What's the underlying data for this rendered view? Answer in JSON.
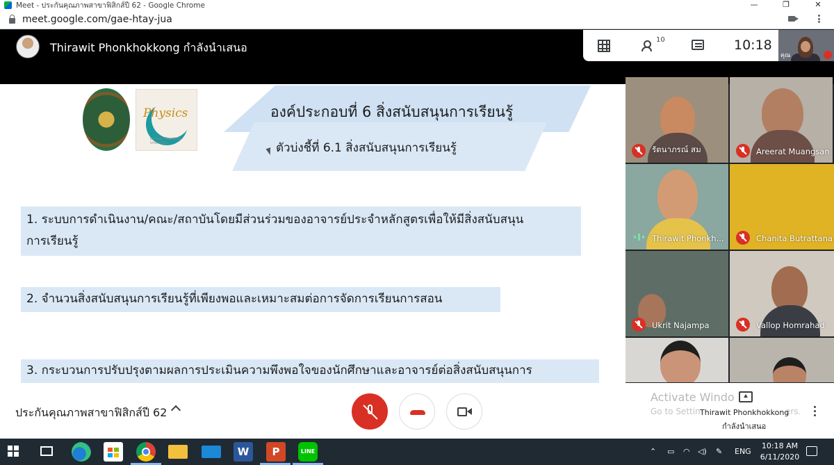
{
  "window": {
    "title": "Meet - ประกันคุณภาพสาขาฟิสิกส์ปี 62 - Google Chrome",
    "controls": [
      "—",
      "❐",
      "✕"
    ]
  },
  "browser": {
    "url": "meet.google.com/gae-htay-jua"
  },
  "header": {
    "presenting_text": "Thirawit Phonkhokkong กำลังนำเสนอ",
    "participants_count": "10",
    "clock": "10:18",
    "self_label": "คุณ"
  },
  "slide": {
    "title": "องค์ประกอบที่ 6 สิ่งสนับสนุนการเรียนรู้",
    "subtitle": "ตัวบ่งชี้ที่ 6.1 สิ่งสนับสนุนการเรียนรู้",
    "logo_text": "Physics",
    "logo_subtext": "Buriram Rajabhat University",
    "items": [
      {
        "line1": "1. ระบบการดำเนินงาน/คณะ/สถาบันโดยมีส่วนร่วมของอาจารย์ประจำหลักสูตรเพื่อให้มีสิ่งสนับสนุน",
        "line2": "การเรียนรู้"
      },
      {
        "line1": "2. จำนวนสิ่งสนับสนุนการเรียนรู้ที่เพียงพอและเหมาะสมต่อการจัดการเรียนการสอน"
      },
      {
        "line1": "3. กระบวนการปรับปรุงตามผลการประเมินความพึงพอใจของนักศึกษาและอาจารย์ต่อสิ่งสนับสนุนการ"
      }
    ]
  },
  "participants": [
    {
      "name": "รัตนาภรณ์ สม",
      "status": "muted"
    },
    {
      "name": "Areerat Muangsan",
      "status": "muted"
    },
    {
      "name": "Thirawit Phonkh...",
      "status": "speaking"
    },
    {
      "name": "Chanita Butrattana",
      "status": "muted"
    },
    {
      "name": "Ukrit Najampa",
      "status": "muted"
    },
    {
      "name": "Vallop Homrahad",
      "status": "muted"
    },
    {
      "name": "",
      "status": ""
    },
    {
      "name": "",
      "status": ""
    }
  ],
  "controls": {
    "meeting_title": "ประกันคุณภาพสาขาฟิสิกส์ปี 62",
    "presenter_name": "Thirawit Phonkhokkong",
    "presenter_status": "กำลังนำเสนอ"
  },
  "watermark": {
    "title": "Activate Windo",
    "subtitle": "Go to Settin",
    "subtitle_tail": "ers."
  },
  "taskbar": {
    "tray_lang": "ENG",
    "time": "10:18 AM",
    "date": "6/11/2020",
    "icons": [
      "windows-icon",
      "task-view-icon",
      "edge-icon",
      "store-icon",
      "chrome-icon",
      "file-explorer-icon",
      "mail-icon",
      "word-icon",
      "powerpoint-icon",
      "line-icon"
    ],
    "word_letter": "W",
    "ppt_letter": "P",
    "line_text": "LINE"
  },
  "colors": {
    "banner": "#cfe1f3",
    "item_bg": "#dae8f6",
    "mute_red": "#d93025",
    "end_call_red": "#d93025",
    "taskbar": "#1f2a33"
  }
}
